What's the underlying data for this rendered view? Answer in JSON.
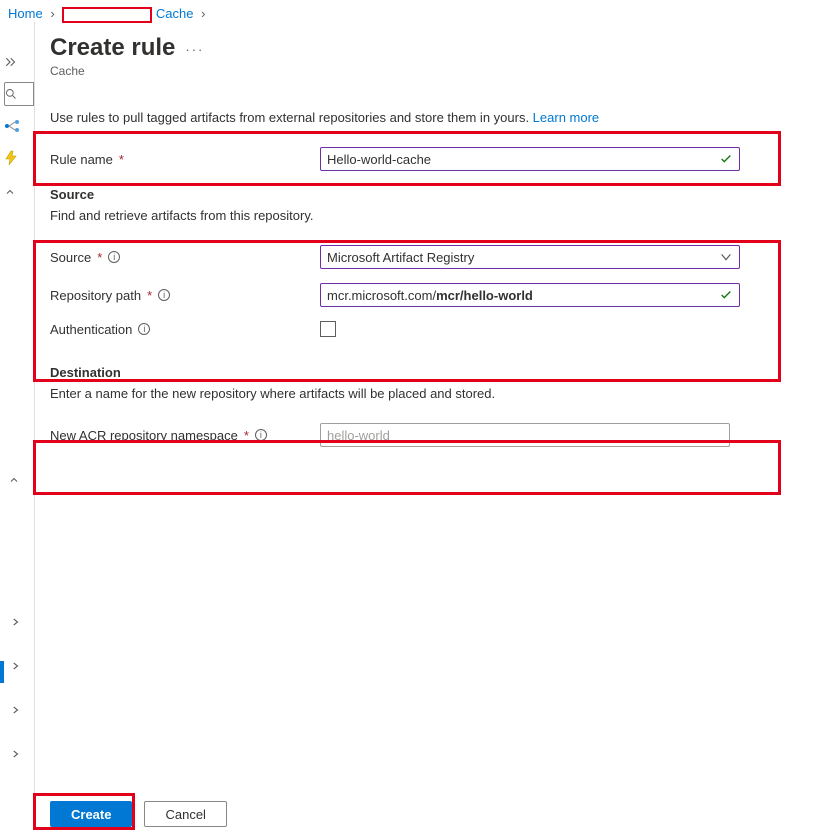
{
  "breadcrumb": {
    "home": "Home",
    "cache": "Cache"
  },
  "page": {
    "title": "Create rule",
    "subtitle": "Cache",
    "intro_text": "Use rules to pull tagged artifacts from external repositories and store them in yours. ",
    "learn_more": "Learn more"
  },
  "rule_name": {
    "label": "Rule name",
    "value": "Hello-world-cache"
  },
  "source": {
    "heading": "Source",
    "description": "Find and retrieve artifacts from this repository.",
    "source_label": "Source",
    "source_value": "Microsoft Artifact Registry",
    "repo_label": "Repository path",
    "repo_prefix": "mcr.microsoft.com/",
    "repo_bold": "mcr/hello-world",
    "auth_label": "Authentication"
  },
  "destination": {
    "heading": "Destination",
    "description": "Enter a name for the new repository where artifacts will be placed and stored.",
    "ns_label": "New ACR repository namespace",
    "ns_value": "hello-world"
  },
  "footer": {
    "create": "Create",
    "cancel": "Cancel"
  }
}
